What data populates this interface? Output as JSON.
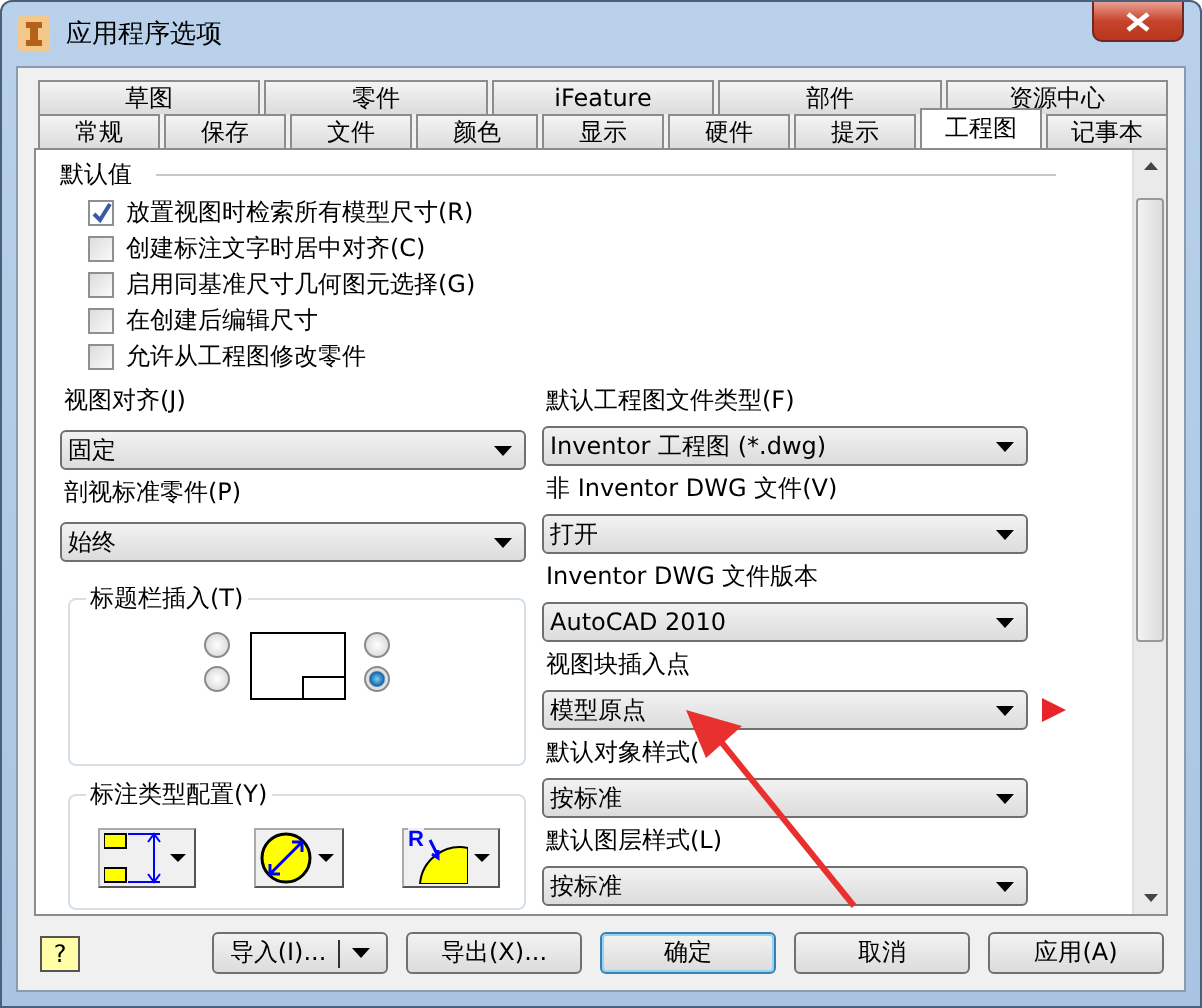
{
  "window": {
    "title": "应用程序选项"
  },
  "tabs_row_1": [
    {
      "label": "草图",
      "selected": false
    },
    {
      "label": "零件",
      "selected": false
    },
    {
      "label": "iFeature",
      "selected": false
    },
    {
      "label": "部件",
      "selected": false
    },
    {
      "label": "资源中心",
      "selected": false
    }
  ],
  "tabs_row_2": [
    {
      "label": "常规",
      "selected": false
    },
    {
      "label": "保存",
      "selected": false
    },
    {
      "label": "文件",
      "selected": false
    },
    {
      "label": "颜色",
      "selected": false
    },
    {
      "label": "显示",
      "selected": false
    },
    {
      "label": "硬件",
      "selected": false
    },
    {
      "label": "提示",
      "selected": false
    },
    {
      "label": "工程图",
      "selected": true
    },
    {
      "label": "记事本",
      "selected": false
    }
  ],
  "section": {
    "title": "默认值"
  },
  "checkboxes": [
    {
      "label": "放置视图时检索所有模型尺寸(R)",
      "checked": true
    },
    {
      "label": "创建标注文字时居中对齐(C)",
      "checked": false
    },
    {
      "label": "启用同基准尺寸几何图元选择(G)",
      "checked": false
    },
    {
      "label": "在创建后编辑尺寸",
      "checked": false
    },
    {
      "label": "允许从工程图修改零件",
      "checked": false
    }
  ],
  "left_fields": [
    {
      "label": "视图对齐(J)",
      "value": "固定"
    },
    {
      "label": "剖视标准零件(P)",
      "value": "始终"
    }
  ],
  "title_block_insertion": {
    "title": "标题栏插入(T)",
    "corners": [
      {
        "selected": false
      },
      {
        "selected": false
      },
      {
        "selected": false
      },
      {
        "selected": true
      }
    ]
  },
  "dimension_type": {
    "title": "标注类型配置(Y)",
    "buttons": [
      {
        "kind": "linear"
      },
      {
        "kind": "diameter"
      },
      {
        "kind": "radius",
        "symbol": "R"
      }
    ]
  },
  "right_fields": [
    {
      "label": "默认工程图文件类型(F)",
      "value": "Inventor 工程图 (*.dwg)",
      "annotated": false
    },
    {
      "label": "非 Inventor DWG 文件(V)",
      "value": "打开",
      "annotated": false
    },
    {
      "label": "Inventor DWG 文件版本",
      "value": "AutoCAD 2010",
      "annotated": false
    },
    {
      "label": "视图块插入点",
      "value": "模型原点",
      "annotated": true
    },
    {
      "label": "默认对象样式(",
      "value": "按标准",
      "annotated": false
    },
    {
      "label": "默认图层样式(L)",
      "value": "按标准",
      "annotated": false
    }
  ],
  "help_button": "?",
  "buttons": [
    {
      "label": "导入(I)...",
      "kind": "split",
      "default": false
    },
    {
      "label": "导出(X)...",
      "kind": "plain",
      "default": false
    },
    {
      "label": "确定",
      "kind": "plain",
      "default": true
    },
    {
      "label": "取消",
      "kind": "plain",
      "default": false
    },
    {
      "label": "应用(A)",
      "kind": "plain",
      "default": false
    }
  ]
}
